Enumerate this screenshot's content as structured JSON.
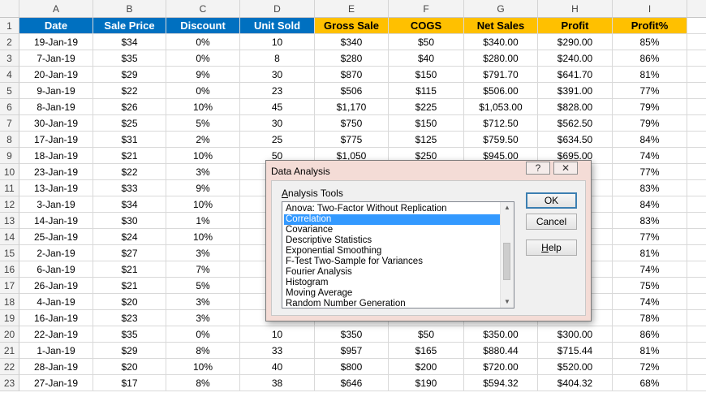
{
  "spreadsheet": {
    "col_letters": [
      "A",
      "B",
      "C",
      "D",
      "E",
      "F",
      "G",
      "H",
      "I"
    ],
    "header_row_number": "1",
    "headers": [
      "Date",
      "Sale Price",
      "Discount",
      "Unit Sold",
      "Gross Sale",
      "COGS",
      "Net Sales",
      "Profit",
      "Profit%"
    ],
    "rows": [
      {
        "num": "2",
        "cells": [
          "19-Jan-19",
          "$34",
          "0%",
          "10",
          "$340",
          "$50",
          "$340.00",
          "$290.00",
          "85%"
        ]
      },
      {
        "num": "3",
        "cells": [
          "7-Jan-19",
          "$35",
          "0%",
          "8",
          "$280",
          "$40",
          "$280.00",
          "$240.00",
          "86%"
        ]
      },
      {
        "num": "4",
        "cells": [
          "20-Jan-19",
          "$29",
          "9%",
          "30",
          "$870",
          "$150",
          "$791.70",
          "$641.70",
          "81%"
        ]
      },
      {
        "num": "5",
        "cells": [
          "9-Jan-19",
          "$22",
          "0%",
          "23",
          "$506",
          "$115",
          "$506.00",
          "$391.00",
          "77%"
        ]
      },
      {
        "num": "6",
        "cells": [
          "8-Jan-19",
          "$26",
          "10%",
          "45",
          "$1,170",
          "$225",
          "$1,053.00",
          "$828.00",
          "79%"
        ]
      },
      {
        "num": "7",
        "cells": [
          "30-Jan-19",
          "$25",
          "5%",
          "30",
          "$750",
          "$150",
          "$712.50",
          "$562.50",
          "79%"
        ]
      },
      {
        "num": "8",
        "cells": [
          "17-Jan-19",
          "$31",
          "2%",
          "25",
          "$775",
          "$125",
          "$759.50",
          "$634.50",
          "84%"
        ]
      },
      {
        "num": "9",
        "cells": [
          "18-Jan-19",
          "$21",
          "10%",
          "50",
          "$1,050",
          "$250",
          "$945.00",
          "$695.00",
          "74%"
        ]
      },
      {
        "num": "10",
        "cells": [
          "23-Jan-19",
          "$22",
          "3%",
          "",
          "",
          "",
          "",
          "",
          "77%"
        ]
      },
      {
        "num": "11",
        "cells": [
          "13-Jan-19",
          "$33",
          "9%",
          "",
          "",
          "",
          "",
          "",
          "83%"
        ]
      },
      {
        "num": "12",
        "cells": [
          "3-Jan-19",
          "$34",
          "10%",
          "",
          "",
          "",
          "",
          "",
          "84%"
        ]
      },
      {
        "num": "13",
        "cells": [
          "14-Jan-19",
          "$30",
          "1%",
          "",
          "",
          "",
          "",
          "",
          "83%"
        ]
      },
      {
        "num": "14",
        "cells": [
          "25-Jan-19",
          "$24",
          "10%",
          "",
          "",
          "",
          "",
          "",
          "77%"
        ]
      },
      {
        "num": "15",
        "cells": [
          "2-Jan-19",
          "$27",
          "3%",
          "",
          "",
          "",
          "",
          "",
          "81%"
        ]
      },
      {
        "num": "16",
        "cells": [
          "6-Jan-19",
          "$21",
          "7%",
          "",
          "",
          "",
          "",
          "",
          "74%"
        ]
      },
      {
        "num": "17",
        "cells": [
          "26-Jan-19",
          "$21",
          "5%",
          "",
          "",
          "",
          "",
          "",
          "75%"
        ]
      },
      {
        "num": "18",
        "cells": [
          "4-Jan-19",
          "$20",
          "3%",
          "",
          "",
          "",
          "",
          "",
          "74%"
        ]
      },
      {
        "num": "19",
        "cells": [
          "16-Jan-19",
          "$23",
          "3%",
          "",
          "",
          "",
          "",
          "",
          "78%"
        ]
      },
      {
        "num": "20",
        "cells": [
          "22-Jan-19",
          "$35",
          "0%",
          "10",
          "$350",
          "$50",
          "$350.00",
          "$300.00",
          "86%"
        ]
      },
      {
        "num": "21",
        "cells": [
          "1-Jan-19",
          "$29",
          "8%",
          "33",
          "$957",
          "$165",
          "$880.44",
          "$715.44",
          "81%"
        ]
      },
      {
        "num": "22",
        "cells": [
          "28-Jan-19",
          "$20",
          "10%",
          "40",
          "$800",
          "$200",
          "$720.00",
          "$520.00",
          "72%"
        ]
      },
      {
        "num": "23",
        "cells": [
          "27-Jan-19",
          "$17",
          "8%",
          "38",
          "$646",
          "$190",
          "$594.32",
          "$404.32",
          "68%"
        ]
      }
    ],
    "colors": {
      "header_blue": "#0070c0",
      "header_gold": "#ffc000"
    }
  },
  "dialog": {
    "title": "Data Analysis",
    "help_label": "?",
    "close_label": "✕",
    "tools_label_prefix": "A",
    "tools_label_rest": "nalysis Tools",
    "items": [
      "Anova: Two-Factor Without Replication",
      "Correlation",
      "Covariance",
      "Descriptive Statistics",
      "Exponential Smoothing",
      "F-Test Two-Sample for Variances",
      "Fourier Analysis",
      "Histogram",
      "Moving Average",
      "Random Number Generation"
    ],
    "selected_index": 1,
    "scroll_up": "▲",
    "scroll_down": "▼",
    "ok_label": "OK",
    "cancel_label": "Cancel",
    "help_button_prefix": "H",
    "help_button_rest": "elp"
  }
}
